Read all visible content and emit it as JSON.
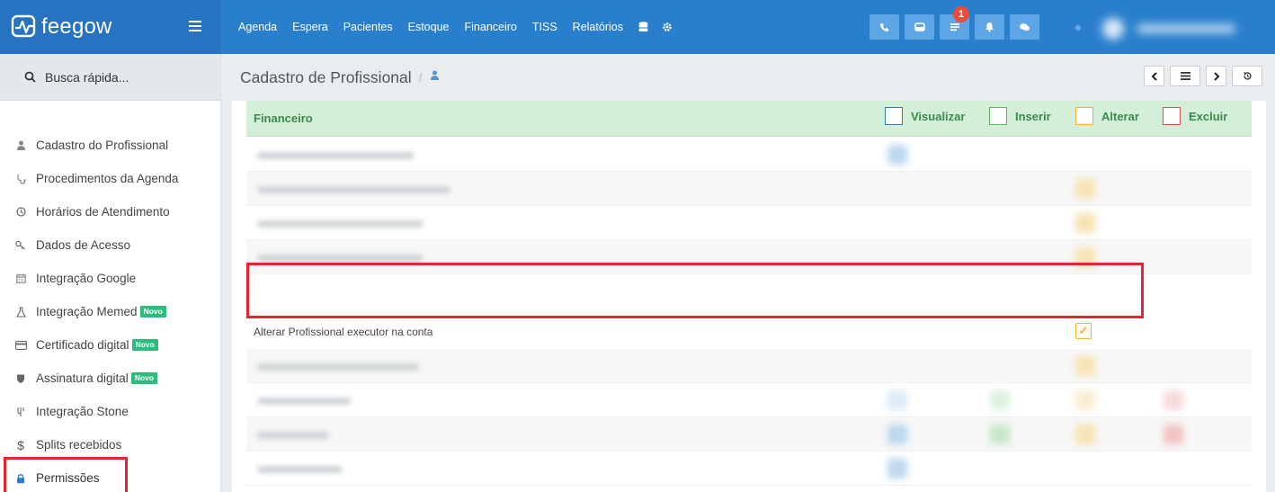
{
  "brand": {
    "name": "feegow"
  },
  "nav": {
    "items": [
      "Agenda",
      "Espera",
      "Pacientes",
      "Estoque",
      "Financeiro",
      "TISS",
      "Relatórios"
    ],
    "notification_count": "1"
  },
  "sidebar": {
    "search_label": "Busca rápida...",
    "items": [
      {
        "label": "Cadastro do Profissional",
        "icon": "user-md-icon"
      },
      {
        "label": "Procedimentos da Agenda",
        "icon": "stethoscope-icon"
      },
      {
        "label": "Horários de Atendimento",
        "icon": "clock-icon"
      },
      {
        "label": "Dados de Acesso",
        "icon": "key-icon"
      },
      {
        "label": "Integração Google",
        "icon": "calendar-icon"
      },
      {
        "label": "Integração Memed",
        "icon": "flask-icon",
        "badge": "Novo"
      },
      {
        "label": "Certificado digital",
        "icon": "credit-card-icon",
        "badge": "Novo"
      },
      {
        "label": "Assinatura digital",
        "icon": "shield-icon",
        "badge": "Novo"
      },
      {
        "label": "Integração Stone",
        "icon": "stone-icon"
      },
      {
        "label": "Splits recebidos",
        "icon": "dollar-icon"
      },
      {
        "label": "Permissões",
        "icon": "lock-icon"
      }
    ]
  },
  "page": {
    "title": "Cadastro de Profissional",
    "separator": "/"
  },
  "permissions": {
    "section_title": "Financeiro",
    "columns": [
      {
        "label": "Visualizar",
        "color": "#2a7fcd"
      },
      {
        "label": "Inserir",
        "color": "#5cb85c"
      },
      {
        "label": "Alterar",
        "color": "#f2b134"
      },
      {
        "label": "Excluir",
        "color": "#d9534f"
      }
    ],
    "focus_row": {
      "label": "Alterar Profissional executor na conta",
      "checked_column": "Alterar"
    }
  },
  "colors": {
    "topbar": "#2a7fcd",
    "highlight": "#e8252e",
    "section_bg": "#d4efd8"
  }
}
